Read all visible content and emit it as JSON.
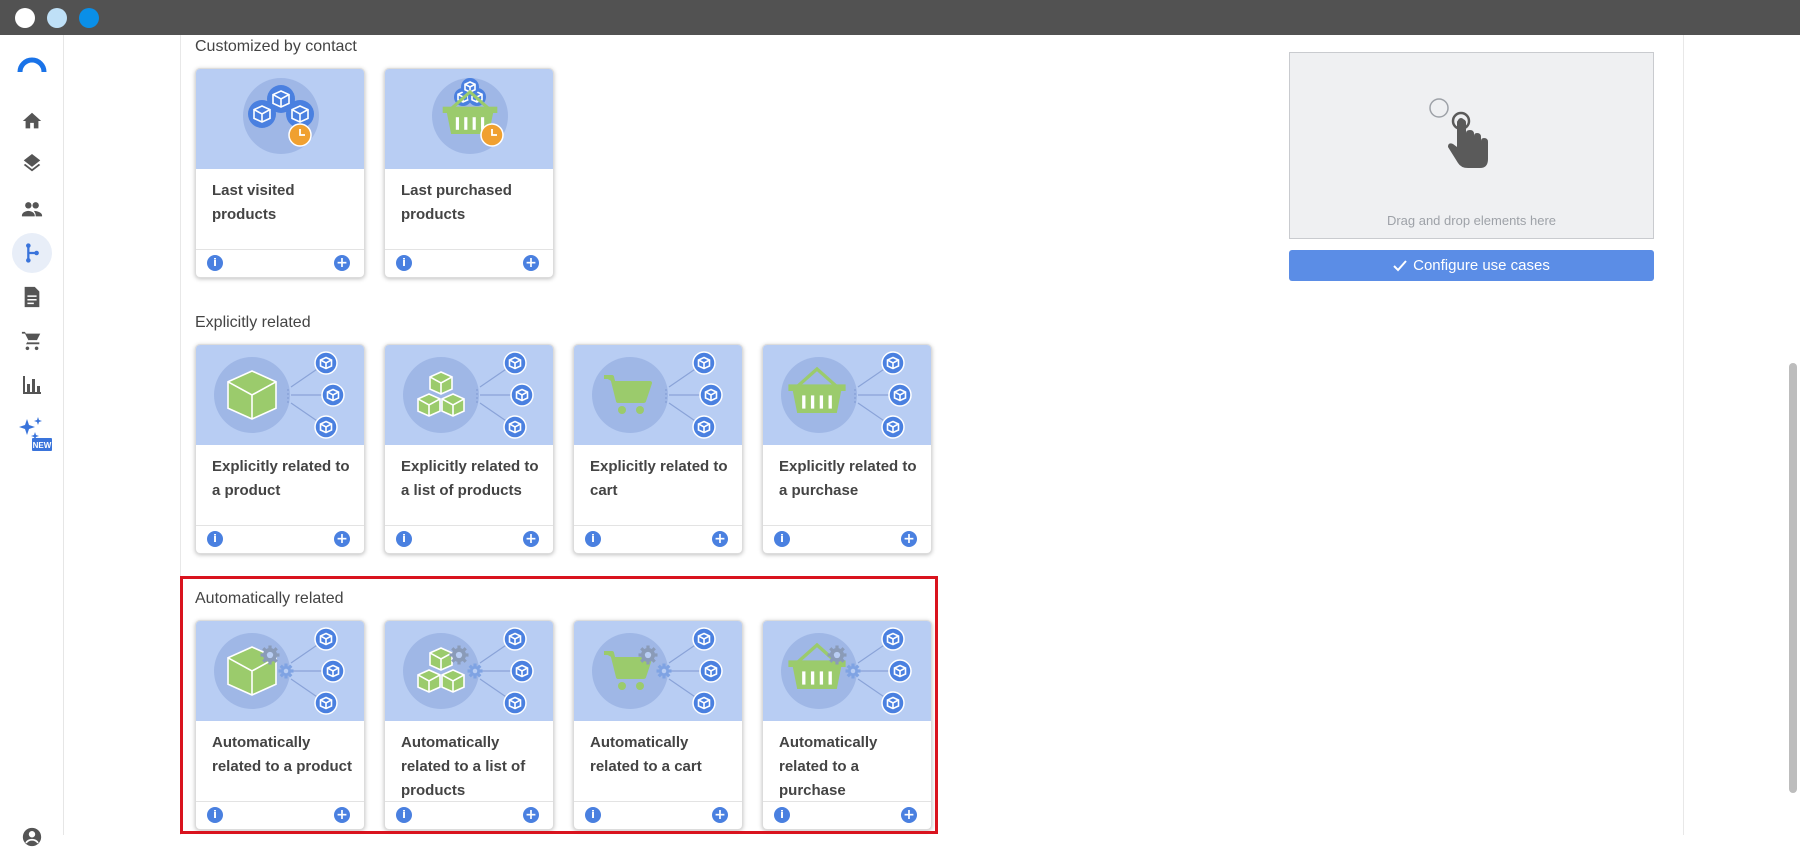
{
  "window": {
    "controls": [
      "close",
      "minimize",
      "maximize"
    ],
    "colors": {
      "close": "#ffffff",
      "minimize": "#bfe0f7",
      "maximize": "#0a8fe8"
    }
  },
  "sidebar": {
    "logo": "brand-logo-icon",
    "items": [
      {
        "name": "home",
        "icon": "home-icon"
      },
      {
        "name": "layers",
        "icon": "layers-icon"
      },
      {
        "name": "contacts",
        "icon": "people-icon"
      },
      {
        "name": "scenarios",
        "icon": "branch-icon",
        "active": true
      },
      {
        "name": "documents",
        "icon": "document-icon"
      },
      {
        "name": "cart",
        "icon": "cart-icon"
      },
      {
        "name": "analytics",
        "icon": "bar-chart-icon"
      },
      {
        "name": "ai",
        "icon": "sparkle-icon",
        "badge": "NEW"
      }
    ],
    "profile": "user-avatar-icon"
  },
  "sections": [
    {
      "title": "Customized by contact",
      "cards": [
        {
          "title": "Last visited products",
          "image": "boxes-clock"
        },
        {
          "title": "Last purchased products",
          "image": "basket-clock"
        }
      ]
    },
    {
      "title": "Explicitly related",
      "cards": [
        {
          "title": "Explicitly related to a product",
          "image": "box-related"
        },
        {
          "title": "Explicitly related to a list of products",
          "image": "boxes-related"
        },
        {
          "title": "Explicitly related to cart",
          "image": "cart-related"
        },
        {
          "title": "Explicitly related to a purchase",
          "image": "basket-related"
        }
      ]
    },
    {
      "title": "Automatically related",
      "cards": [
        {
          "title": "Automatically related to a product",
          "image": "box-auto"
        },
        {
          "title": "Automatically related to a list of products",
          "image": "boxes-auto"
        },
        {
          "title": "Automatically related to a cart",
          "image": "cart-auto"
        },
        {
          "title": "Automatically related to a purchase",
          "image": "basket-auto"
        }
      ]
    }
  ],
  "card_actions": {
    "info": "i",
    "add": "+"
  },
  "dropzone": {
    "text": "Drag and drop elements here"
  },
  "configure": {
    "label": "Configure use cases"
  },
  "colors": {
    "card_image": "#b8cdf3",
    "accent": "#4a80e0",
    "highlight": "#d9131e",
    "green": "#9bcb6c"
  }
}
